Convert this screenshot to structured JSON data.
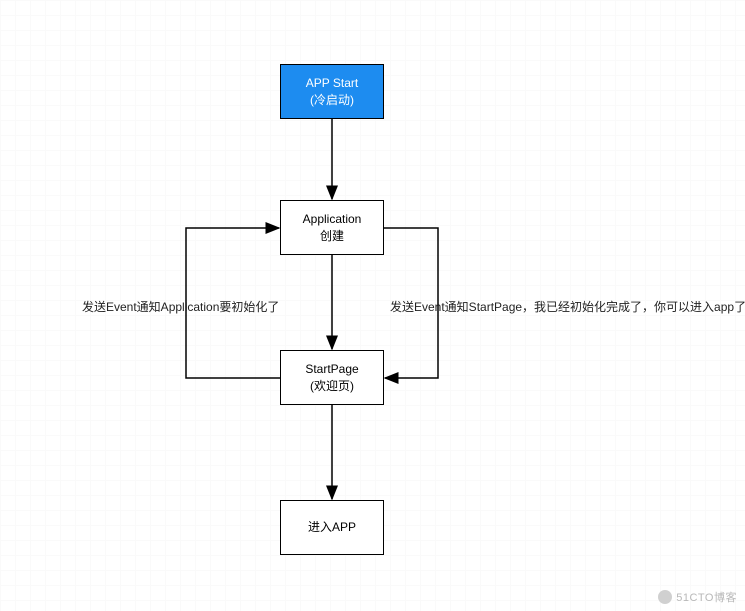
{
  "nodes": {
    "app_start": {
      "title": "APP Start",
      "subtitle": "(冷启动)"
    },
    "application": {
      "title": "Application",
      "subtitle": "创建"
    },
    "start_page": {
      "title": "StartPage",
      "subtitle": "(欢迎页)"
    },
    "enter_app": {
      "title": "进入APP"
    }
  },
  "edges": {
    "left_label": "发送Event通知Application要初始化了",
    "right_label": "发送Event通知StartPage，我已经初始化完成了，你可以进入app了"
  },
  "watermark": "51CTO博客",
  "colors": {
    "accent": "#1d8cf0"
  }
}
